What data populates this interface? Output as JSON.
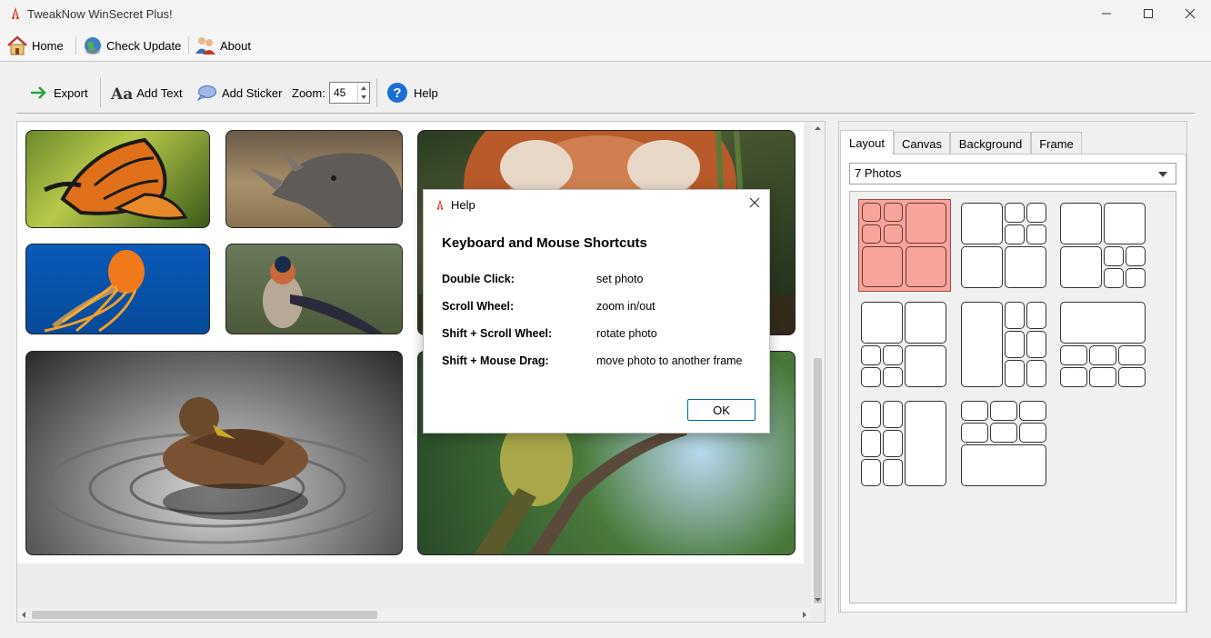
{
  "window": {
    "title": "TweakNow WinSecret Plus!"
  },
  "menu": {
    "home": "Home",
    "check_update": "Check Update",
    "about": "About"
  },
  "toolbar": {
    "export": "Export",
    "add_text": "Add Text",
    "add_text_glyph": "Aa",
    "add_sticker": "Add Sticker",
    "zoom_label": "Zoom:",
    "zoom_value": "45",
    "help": "Help"
  },
  "tabs": {
    "layout": "Layout",
    "canvas": "Canvas",
    "background": "Background",
    "frame": "Frame"
  },
  "layout_select": {
    "value": "7 Photos"
  },
  "photos": [
    "butterfly",
    "rhinoceros",
    "red-panda",
    "jellyfish",
    "swallow",
    "duck",
    "bird-on-branch"
  ],
  "dialog": {
    "title": "Help",
    "heading": "Keyboard and Mouse Shortcuts",
    "shortcuts": [
      {
        "key": "Double Click:",
        "action": "set photo"
      },
      {
        "key": "Scroll Wheel:",
        "action": "zoom in/out"
      },
      {
        "key": "Shift + Scroll Wheel:",
        "action": "rotate photo"
      },
      {
        "key": "Shift + Mouse Drag:",
        "action": "move photo to another frame"
      }
    ],
    "ok": "OK"
  },
  "colors": {
    "selected_layout": "#f8a49b",
    "accent": "#0067c0"
  }
}
